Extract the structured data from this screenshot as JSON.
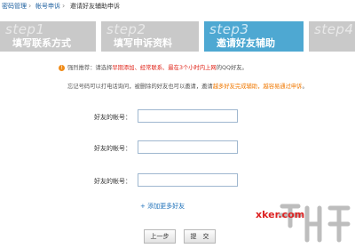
{
  "breadcrumb": {
    "items": [
      "密码管理",
      "帐号申诉",
      "邀请好友辅助申诉"
    ]
  },
  "steps": [
    {
      "num": "step1",
      "label": "填写联系方式",
      "active": false
    },
    {
      "num": "step2",
      "label": "填写申诉资料",
      "active": false
    },
    {
      "num": "step3",
      "label": "邀请好友辅助",
      "active": true
    },
    {
      "num": "step4",
      "label": "",
      "active": false
    }
  ],
  "notice": {
    "icon": "!",
    "prefix": "强烈推荐：请选择",
    "highlight": "早期添加、经常联系、最在3个小时内上网",
    "suffix": "的QQ好友。"
  },
  "note": {
    "prefix": "忘记号码可以打电话询问，被删除的好友也可以邀请，邀请",
    "highlight": "越多好友完成辅助，越容易通过申诉",
    "suffix": "。"
  },
  "form": {
    "friend_label": "好友的帐号：",
    "friend_values": [
      "",
      "",
      ""
    ]
  },
  "add_more": "+ 添加更多好友",
  "buttons": {
    "prev": "上一步",
    "submit": "提　交"
  },
  "watermark": {
    "text": "xker.com"
  },
  "colors": {
    "active_step": "#4ea8d2",
    "inactive_step": "#c9c9c9",
    "link": "#1b6fb8",
    "highlight_red": "#e0251a",
    "highlight_orange": "#f07800"
  }
}
